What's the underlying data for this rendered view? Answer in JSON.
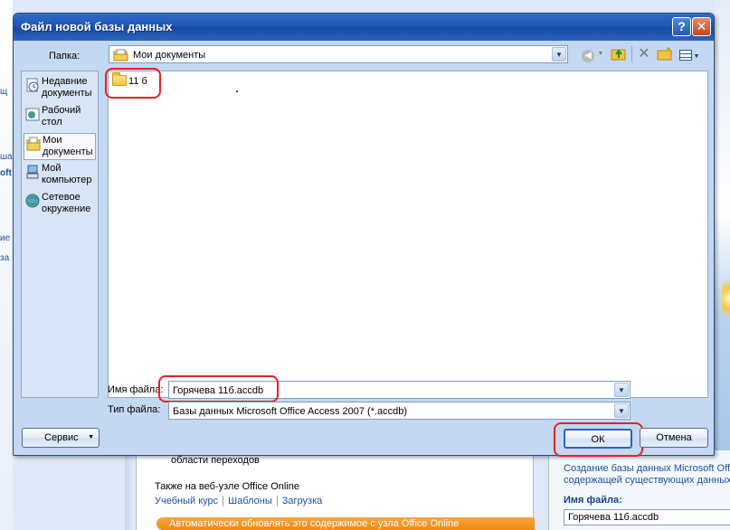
{
  "dialog": {
    "title": "Файл новой базы данных",
    "help_glyph": "?",
    "close_glyph": "✕"
  },
  "lookin": {
    "label": "Папка:",
    "value": "Мои документы"
  },
  "places": [
    {
      "label": "Недавние\nдокументы",
      "icon": "recent-documents-icon"
    },
    {
      "label": "Рабочий\nстол",
      "icon": "desktop-icon"
    },
    {
      "label": "Мои\nдокументы",
      "icon": "my-documents-icon",
      "selected": true
    },
    {
      "label": "Мой\nкомпьютер",
      "icon": "my-computer-icon"
    },
    {
      "label": "Сетевое\nокружение",
      "icon": "network-icon"
    }
  ],
  "files": [
    {
      "name": "11 б",
      "icon": "folder-icon"
    }
  ],
  "filename": {
    "label": "Имя файла:",
    "value": "Горячева 11б.accdb"
  },
  "filetype": {
    "label": "Тип файла:",
    "value": "Базы данных Microsoft Office Access 2007 (*.accdb)"
  },
  "buttons": {
    "service": "Сервис",
    "ok": "ОК",
    "cancel": "Отмена"
  },
  "background": {
    "left_fragments": [
      "щ",
      "ша",
      "oft",
      "ие",
      "за"
    ],
    "nav_pane_text": "области переходов",
    "office_online_heading": "Также на веб-узле Office Online",
    "links": [
      "Учебный курс",
      "Шаблоны",
      "Загрузка"
    ],
    "update_banner": "Автоматически обновлять это содержимое с узла Office Online",
    "right_desc_line1": "Создание базы данных Microsoft Office",
    "right_desc_line2": "содержащей существующих данных",
    "right_filename_label": "Имя файла:",
    "right_filename_value": "Горячева 11б.accdb"
  },
  "colors": {
    "title_bar": "#1f57b4",
    "highlight": "#e8202a",
    "dialog_bg": "#c4d8f2"
  }
}
